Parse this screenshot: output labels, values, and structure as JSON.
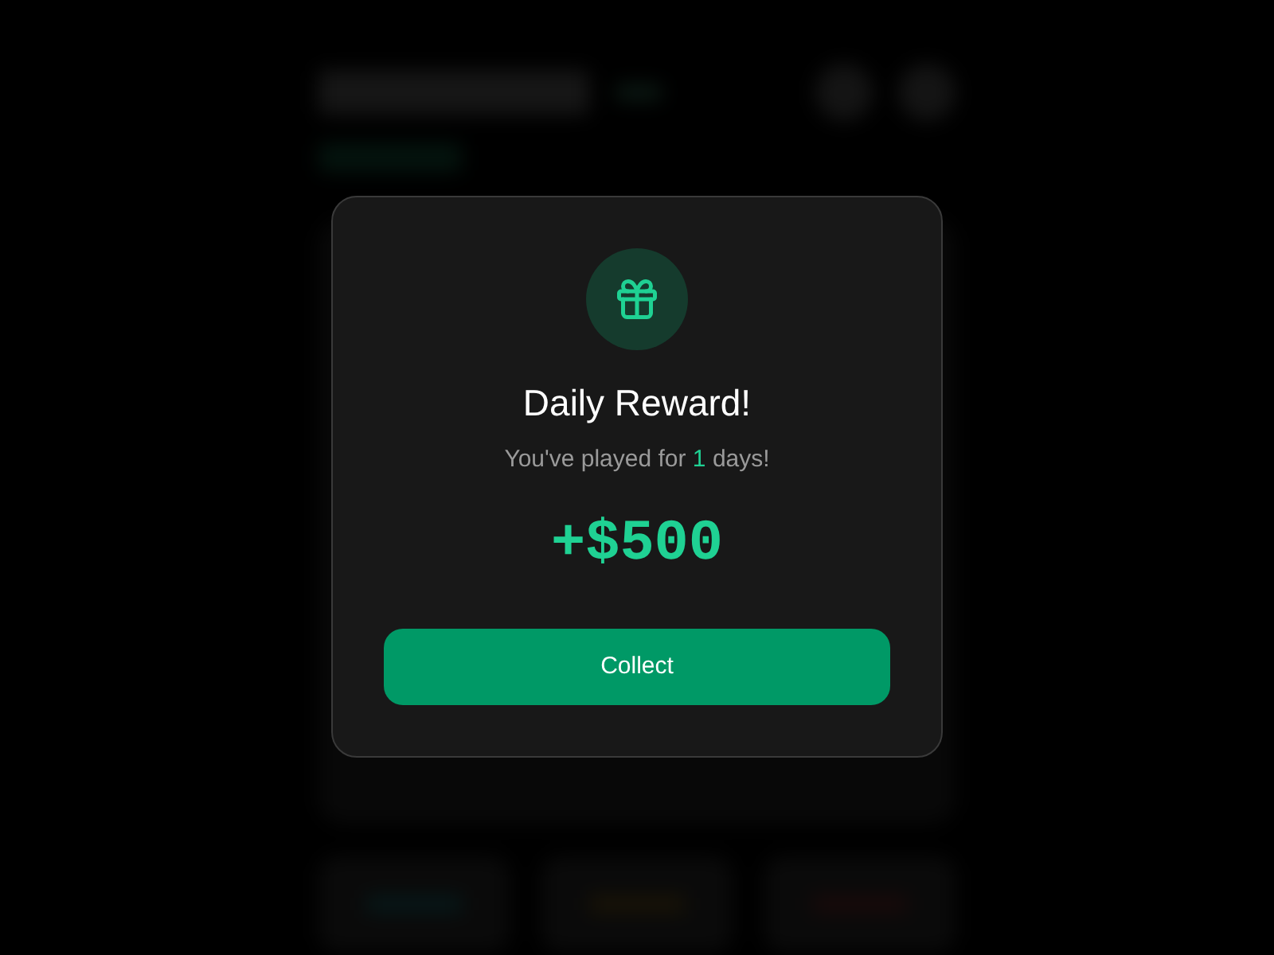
{
  "dialog": {
    "title": "Daily Reward!",
    "message": {
      "text_before": "You've played for",
      "streak_days": "1",
      "text_after": "days!"
    },
    "reward": "+$500",
    "button": {
      "label": "Collect"
    }
  }
}
